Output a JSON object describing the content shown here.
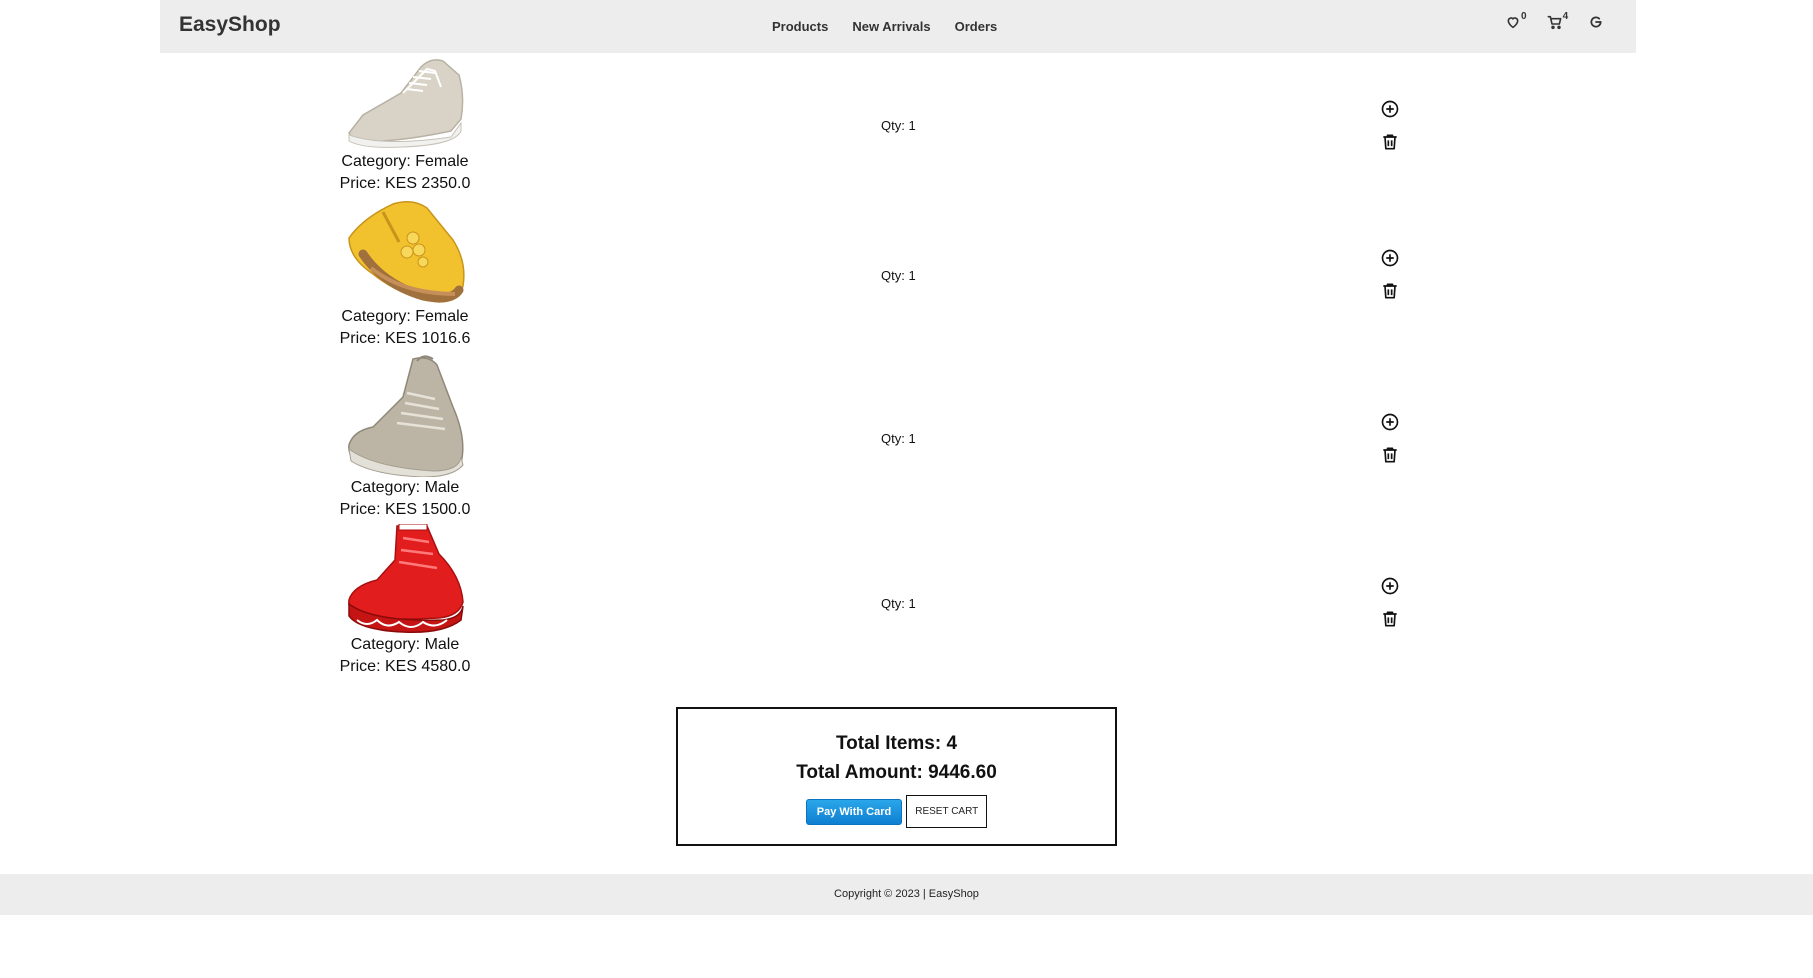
{
  "header": {
    "brand": "EasyShop",
    "nav": [
      "Products",
      "New Arrivals",
      "Orders"
    ],
    "wishlist_count": "0",
    "cart_count": "4"
  },
  "cart": {
    "items": [
      {
        "category": "Category: Female",
        "price": "Price: KES 2350.0",
        "qty": "Qty: 1",
        "image": "beige-canvas-sneaker"
      },
      {
        "category": "Category: Female",
        "price": "Price: KES 1016.6",
        "qty": "Qty: 1",
        "image": "yellow-flower-sandal"
      },
      {
        "category": "Category: Male",
        "price": "Price: KES 1500.0",
        "qty": "Qty: 1",
        "image": "grey-knit-sneaker"
      },
      {
        "category": "Category: Male",
        "price": "Price: KES 4580.0",
        "qty": "Qty: 1",
        "image": "red-high-top-sneaker"
      }
    ]
  },
  "summary": {
    "total_items": "Total Items: 4",
    "total_amount": "Total Amount: 9446.60",
    "pay_label": "Pay With Card",
    "reset_label": "RESET CART"
  },
  "footer": {
    "copyright": "Copyright © 2023 | EasyShop"
  },
  "colors": {
    "navbar_bg": "#ededed",
    "pay_button": "#1a8fdb",
    "footer_bg": "#ededed"
  }
}
